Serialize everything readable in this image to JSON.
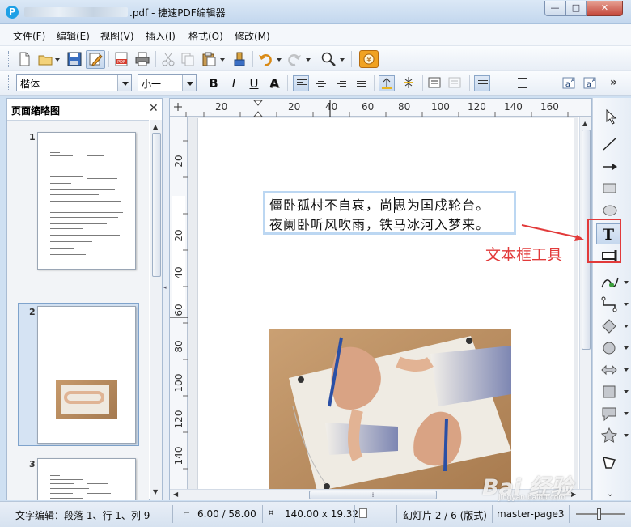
{
  "window": {
    "title": ".pdf - 捷速PDF编辑器",
    "app_icon": "P",
    "minimize_glyph": "—",
    "maximize_glyph": "□",
    "close_glyph": "✕"
  },
  "menu": [
    "文件(F)",
    "编辑(E)",
    "视图(V)",
    "插入(I)",
    "格式(O)",
    "修改(M)"
  ],
  "format_bar": {
    "font_name": "楷体",
    "font_size": "小一",
    "bold": "B",
    "italic": "I",
    "underline": "U",
    "shadow": "A"
  },
  "thumbnails": {
    "title": "页面缩略图",
    "close_glyph": "✕",
    "pages": [
      {
        "number": "1",
        "selected": false
      },
      {
        "number": "2",
        "selected": true
      },
      {
        "number": "3",
        "selected": false
      }
    ]
  },
  "ruler": {
    "horizontal_ticks": [
      "20",
      "20",
      "40",
      "60",
      "80",
      "100",
      "120",
      "140",
      "160"
    ],
    "vertical_ticks": [
      "20",
      "20",
      "40",
      "60",
      "80",
      "100",
      "120",
      "140"
    ]
  },
  "document": {
    "poem_line_1": "僵卧孤村不自哀，尚思为国戍轮台。",
    "poem_line_2": "夜阑卧听风吹雨，铁马冰河入梦来。",
    "image": "hands-drawing-each-other"
  },
  "annotation": {
    "label": "文本框工具",
    "color": "#e23a3a"
  },
  "draw_tools": [
    "select-arrow",
    "line",
    "arrow-line",
    "rectangle",
    "ellipse",
    "text-box",
    "vertical-text",
    "curve",
    "connector",
    "diamond-shape",
    "circle-shape",
    "double-arrow",
    "square-shape",
    "callout",
    "star",
    "polygon"
  ],
  "scroll": {
    "h_grip": "⁞⁞⁞"
  },
  "status": {
    "edit_info": "文字编辑：段落 1、行 1、列 9",
    "position": "6.00 / 58.00",
    "size": "140.00 x 19.32",
    "slide": "幻灯片 2 / 6 (版式)",
    "master": "master-page3"
  },
  "watermark": {
    "text": "Bai 经验",
    "sub": "jingyan.baidu.com"
  },
  "colors": {
    "accent": "#1ea0e6",
    "selection": "#d5e3f3",
    "textbox_border": "#bcd7f2"
  }
}
